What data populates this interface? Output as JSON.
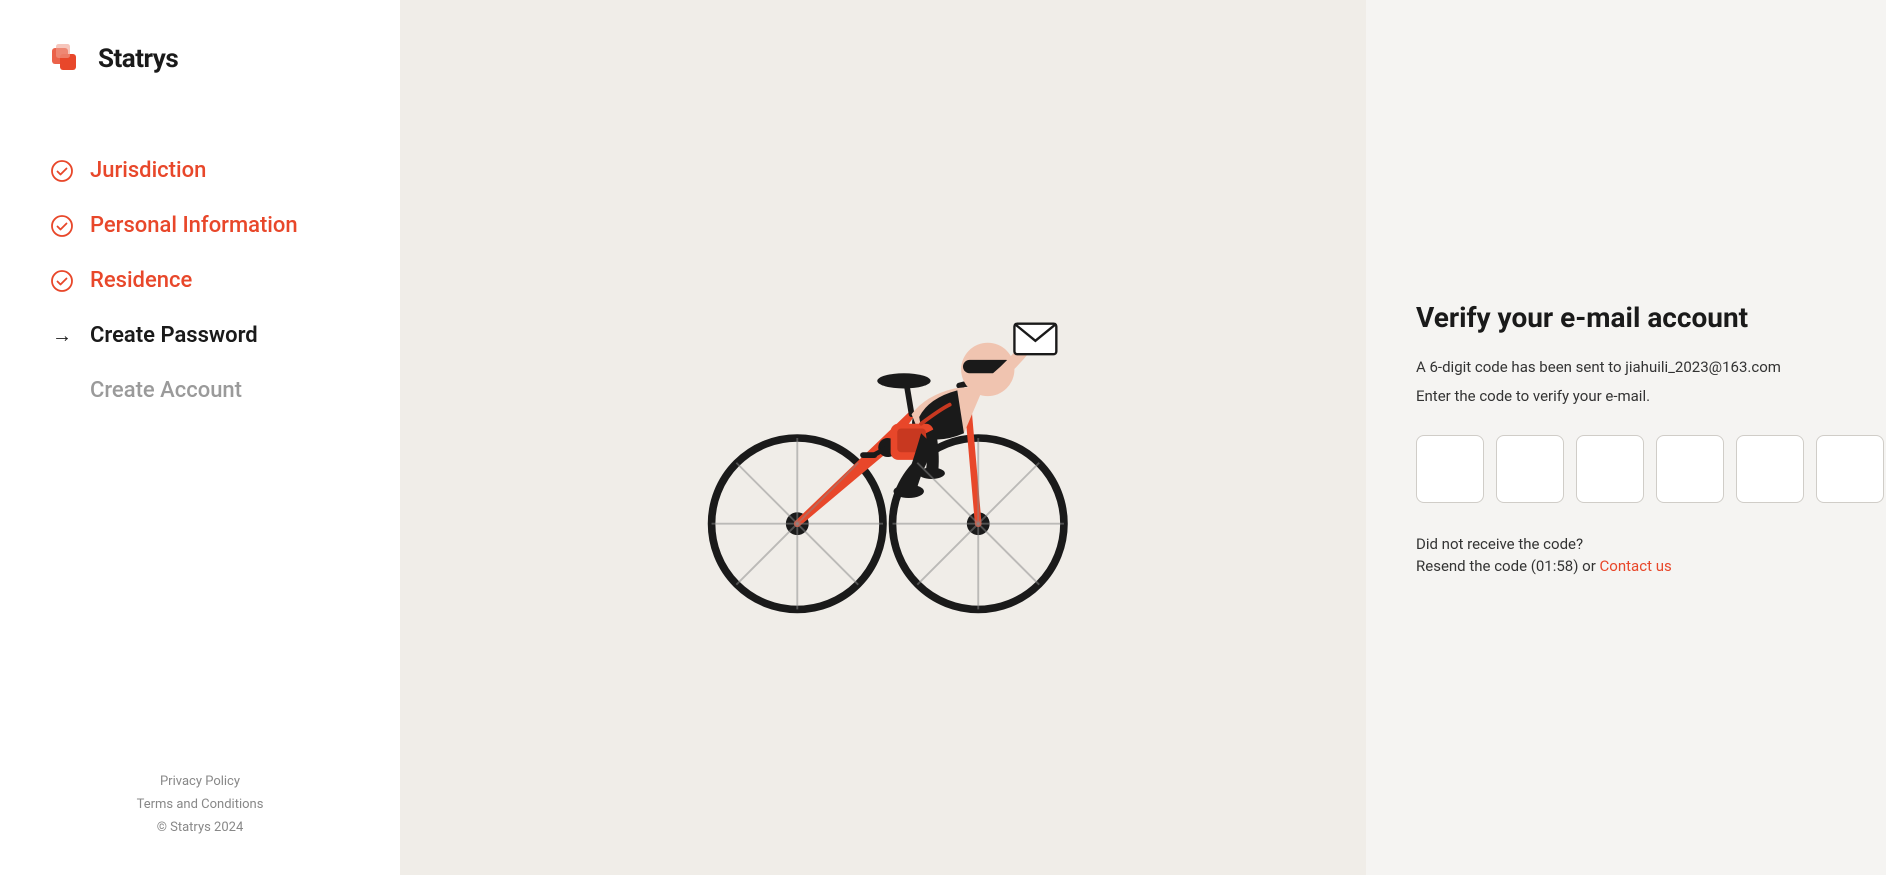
{
  "logo": {
    "text": "Statrys"
  },
  "sidebar": {
    "steps": [
      {
        "id": "jurisdiction",
        "label": "Jurisdiction",
        "state": "completed",
        "icon": "✓"
      },
      {
        "id": "personal-information",
        "label": "Personal Information",
        "state": "completed",
        "icon": "✓"
      },
      {
        "id": "residence",
        "label": "Residence",
        "state": "completed",
        "icon": "✓"
      },
      {
        "id": "create-password",
        "label": "Create Password",
        "state": "active",
        "icon": "→"
      },
      {
        "id": "create-account",
        "label": "Create Account",
        "state": "inactive",
        "icon": ""
      }
    ],
    "footer": {
      "privacy_policy": "Privacy Policy",
      "terms": "Terms and Conditions",
      "copyright": "© Statrys 2024"
    }
  },
  "verify": {
    "title": "Verify your e-mail account",
    "subtitle": "A 6-digit code has been sent to jiahuili_2023@163.com",
    "instruction": "Enter the code to verify your e-mail.",
    "code_placeholders": [
      "",
      "",
      "",
      "",
      "",
      ""
    ],
    "resend": {
      "label": "Did not receive the code?",
      "text": "Resend the code (01:58) or",
      "contact_label": "Contact us"
    }
  },
  "colors": {
    "accent": "#e8472a",
    "text_primary": "#1a1a1a",
    "text_muted": "#888888",
    "completed": "#e8472a"
  }
}
